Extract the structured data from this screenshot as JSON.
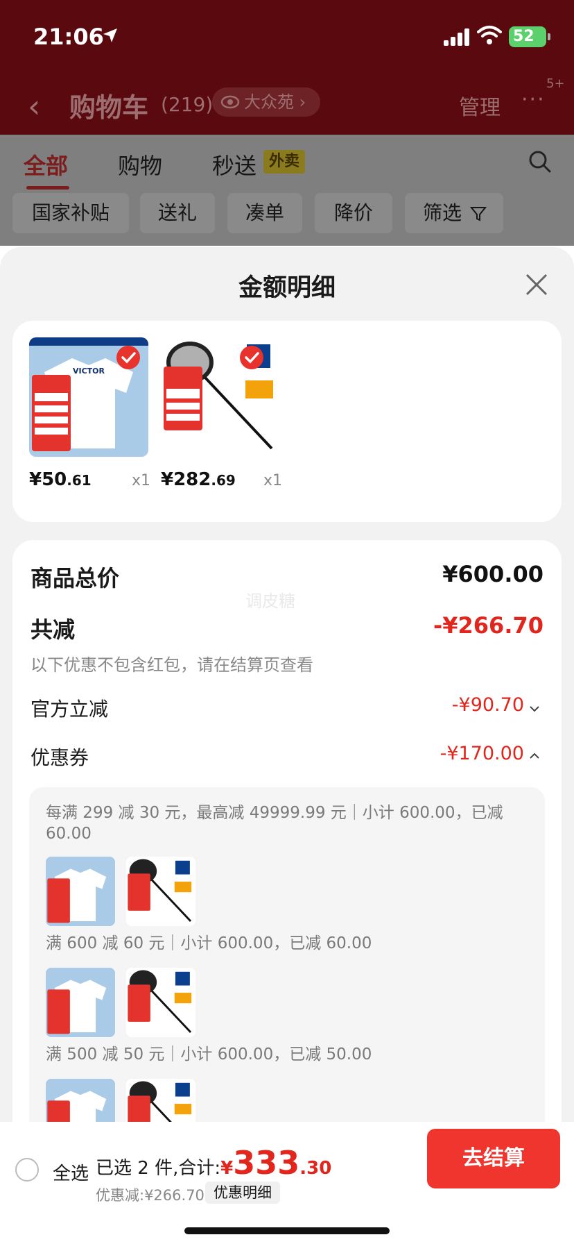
{
  "status": {
    "time": "21:06",
    "battery": "52"
  },
  "nav": {
    "back_icon": "chevron-left-icon",
    "title": "购物车",
    "count": "(219)",
    "location": "大众苑",
    "manage": "管理",
    "more_badge": "5+"
  },
  "tabs": {
    "items": [
      "全部",
      "购物",
      "秒送"
    ],
    "tag": "外卖",
    "filters": [
      "国家补贴",
      "送礼",
      "凑单",
      "降价",
      "筛选"
    ]
  },
  "sheet": {
    "title": "金额明细",
    "products": [
      {
        "price_int": "¥50",
        "price_dec": ".61",
        "qty": "x1"
      },
      {
        "price_int": "¥282",
        "price_dec": ".69",
        "qty": "x1"
      }
    ],
    "total_label": "商品总价",
    "total_value": "¥600.00",
    "watermark": "调皮糖",
    "discount_label": "共减",
    "discount_value": "-¥266.70",
    "discount_note": "以下优惠不包含红包，请在结算页查看",
    "official_label": "官方立减",
    "official_value": "-¥90.70",
    "coupon_label": "优惠券",
    "coupon_value": "-¥170.00",
    "coupon_rules": [
      "每满 299 减 30 元，最高减 49999.99 元｜小计 600.00，已减 60.00",
      "满 600 减 60 元｜小计 600.00，已减 60.00",
      "满 500 减 50 元｜小计 600.00，已减 50.00"
    ]
  },
  "bottom": {
    "select_all": "全选",
    "selected_text": "已选 2 件,合计:",
    "currency": "¥",
    "amount_int": "333",
    "amount_dec": ".30",
    "discount_text": "优惠减:¥266.70",
    "discount_detail": "优惠明细",
    "checkout": "去结算"
  },
  "colors": {
    "accent": "#e0261d",
    "button": "#f0352f",
    "header": "#5a0a0f"
  }
}
